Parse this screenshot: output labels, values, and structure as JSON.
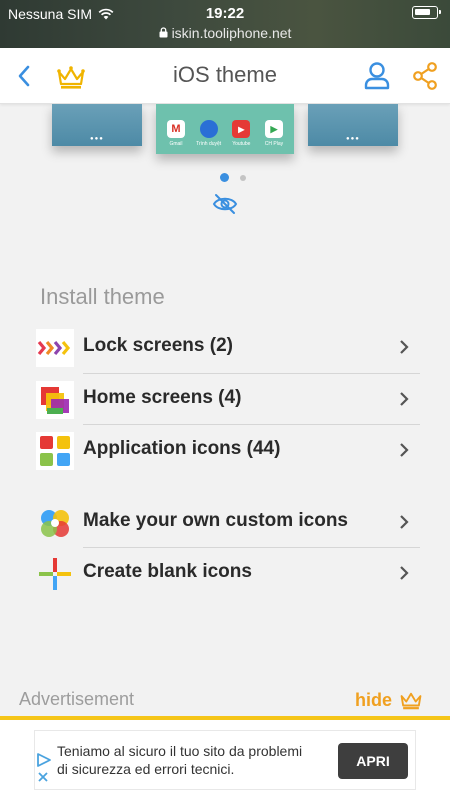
{
  "status_bar": {
    "carrier": "Nessuna SIM",
    "time": "19:22",
    "url": "iskin.tooliphone.net"
  },
  "navbar": {
    "title": "iOS theme",
    "accent_blue": "#3a8fe0",
    "accent_orange": "#f0a020"
  },
  "preview": {
    "apps": [
      {
        "name": "Gmail",
        "icon": "gmail-icon"
      },
      {
        "name": "Trình duyệt",
        "icon": "browser-icon"
      },
      {
        "name": "Youtube",
        "icon": "youtube-icon"
      },
      {
        "name": "CH Play",
        "icon": "play-store-icon"
      }
    ],
    "page_count": 2,
    "current_page": 1
  },
  "install": {
    "title": "Install theme",
    "items": [
      {
        "label": "Lock screens (2)",
        "icon": "lock-screens-icon"
      },
      {
        "label": "Home screens (4)",
        "icon": "home-screens-icon"
      },
      {
        "label": "Application icons (44)",
        "icon": "application-icons-icon"
      }
    ],
    "extra_items": [
      {
        "label": "Make your own custom icons",
        "icon": "custom-icons-icon"
      },
      {
        "label": "Create blank icons",
        "icon": "blank-icons-icon"
      }
    ]
  },
  "advertisement": {
    "label": "Advertisement",
    "hide_label": "hide",
    "text": "Teniamo al sicuro il tuo sito da problemi di sicurezza ed errori tecnici.",
    "button": "APRI"
  }
}
